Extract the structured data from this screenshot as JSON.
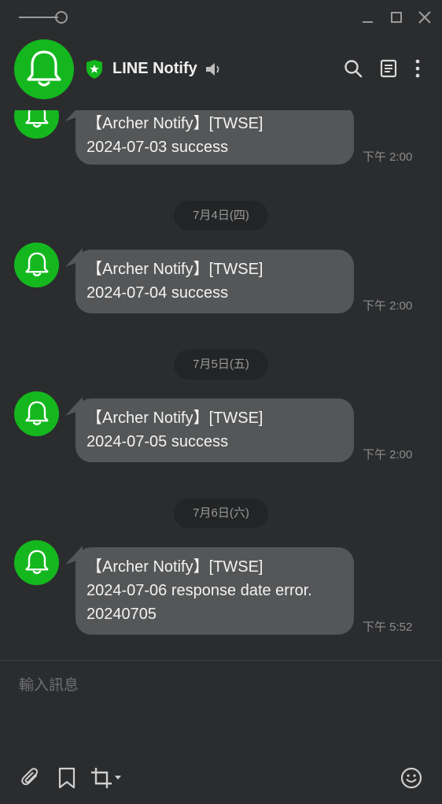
{
  "window": {
    "controls": [
      "opacity-slider",
      "minimize",
      "maximize",
      "close"
    ]
  },
  "header": {
    "chat_name": "LINE Notify",
    "icons": [
      "bell-icon",
      "verified-shield-icon",
      "speaker-icon",
      "search-icon",
      "notes-icon",
      "more-icon"
    ],
    "accent_color": "#14b81e"
  },
  "messages": [
    {
      "lines": [
        "【Archer Notify】[TWSE]",
        "2024-07-03 success"
      ],
      "time": "下午 2:00"
    },
    {
      "lines": [
        "【Archer Notify】[TWSE]",
        "2024-07-04 success"
      ],
      "time": "下午 2:00"
    },
    {
      "lines": [
        "【Archer Notify】[TWSE]",
        "2024-07-05 success"
      ],
      "time": "下午 2:00"
    },
    {
      "lines": [
        "【Archer Notify】[TWSE]",
        "2024-07-06 response date error.",
        "20240705"
      ],
      "time": "下午 5:52"
    }
  ],
  "date_separators": [
    "7月4日(四)",
    "7月5日(五)",
    "7月6日(六)"
  ],
  "composer": {
    "placeholder": "輸入訊息",
    "tools": [
      "attach-icon",
      "bookmark-icon",
      "crop-icon",
      "emoji-icon"
    ]
  }
}
